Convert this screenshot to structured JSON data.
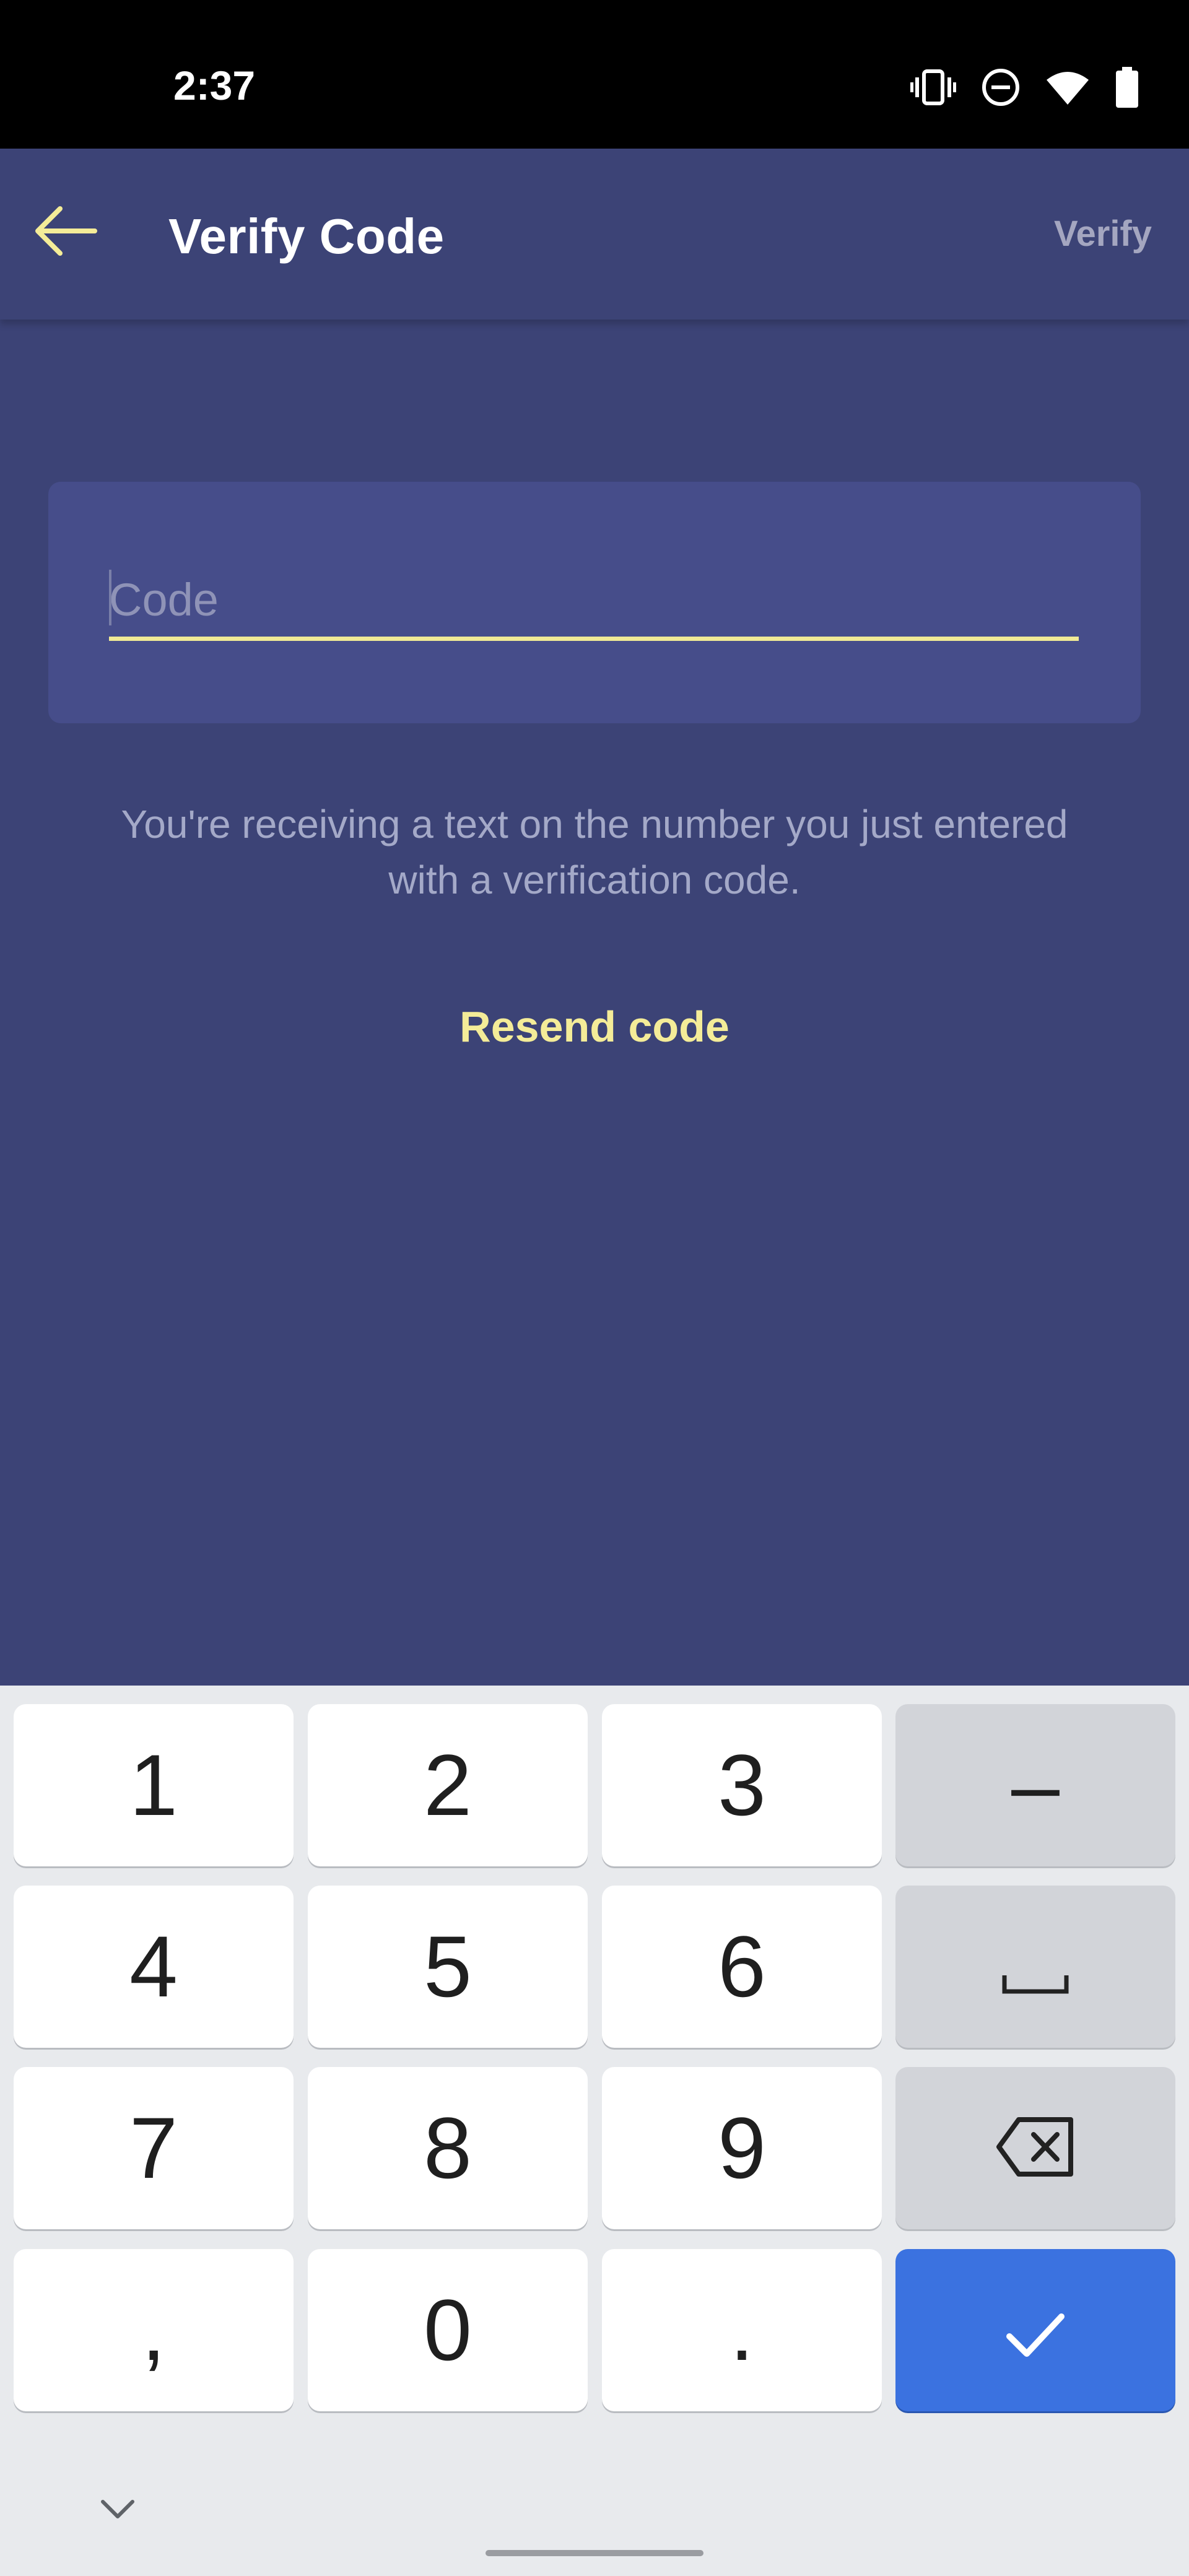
{
  "status_bar": {
    "time": "2:37",
    "icons": [
      "vibrate-icon",
      "do-not-disturb-icon",
      "wifi-icon",
      "battery-icon"
    ]
  },
  "app_bar": {
    "back_icon": "arrow-left-icon",
    "title": "Verify Code",
    "action_label": "Verify"
  },
  "form": {
    "code_value": "",
    "code_placeholder": "Code",
    "helper_text": "You're receiving a text on the number you just entered with a verification code.",
    "resend_label": "Resend code"
  },
  "keyboard": {
    "keys": {
      "k1": "1",
      "k2": "2",
      "k3": "3",
      "dash": "–",
      "k4": "4",
      "k5": "5",
      "k6": "6",
      "k7": "7",
      "k8": "8",
      "k9": "9",
      "comma": ",",
      "k0": "0",
      "period": "."
    },
    "icons": [
      "space-icon",
      "backspace-icon",
      "checkmark-icon",
      "chevron-down-icon"
    ]
  },
  "colors": {
    "background": "#3c4376",
    "accent_yellow": "#f4ec98",
    "input_card": "#464d8a",
    "keyboard_enter": "#3b72e0"
  }
}
